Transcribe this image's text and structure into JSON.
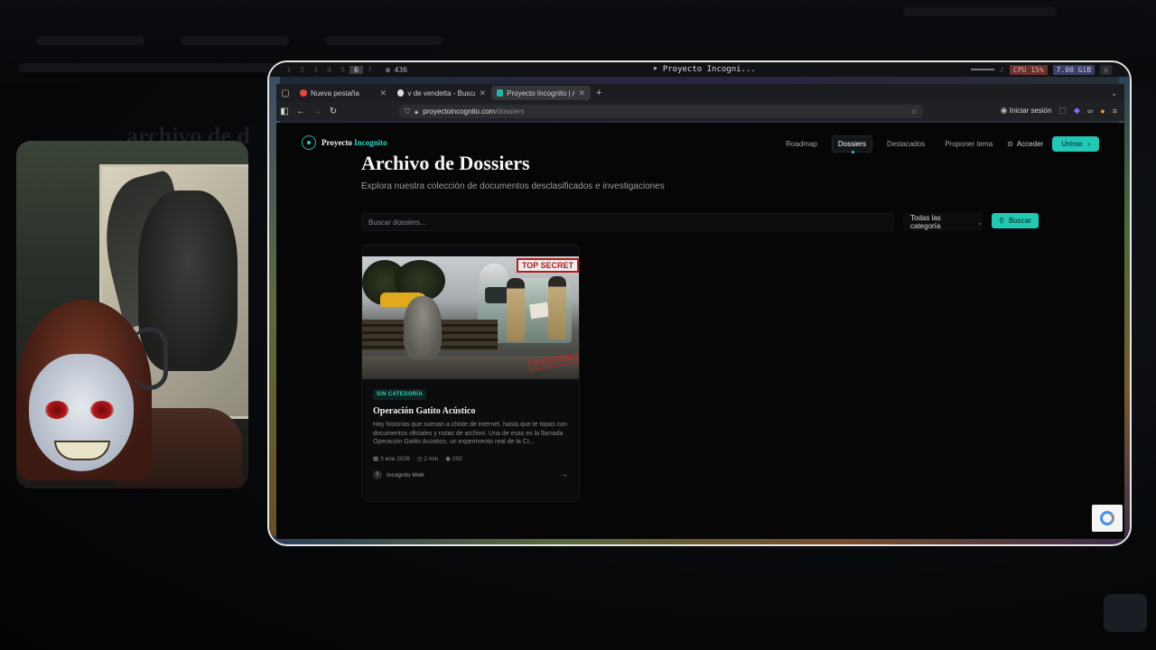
{
  "topbar": {
    "workspaces": [
      "1",
      "2",
      "3",
      "4",
      "5",
      "6",
      "7"
    ],
    "active_workspace": "6",
    "count": "436",
    "window_title": "Proyecto Incogni...",
    "cpu": "CPU 15%",
    "mem": "7.00 GiB"
  },
  "browser": {
    "tabs": [
      {
        "label": "Nueva pestaña",
        "color": "#e8453c"
      },
      {
        "label": "v de vendetta - Buscar",
        "color": "#dddddd"
      },
      {
        "label": "Proyecto Incognito | Arc",
        "color": "#1fb8a6"
      }
    ],
    "url_host": "proyectoincognito.com",
    "url_path": "/dossiers",
    "signin_label": "Iniciar sesión"
  },
  "site": {
    "brand_first": "Proyecto",
    "brand_accent": "Incognito",
    "nav": [
      "Roadmap",
      "Dossiers",
      "Destacados",
      "Proponer tema"
    ],
    "active_nav": "Dossiers",
    "login_label": "Acceder",
    "join_label": "Unirse",
    "page_title": "Archivo de Dossiers",
    "page_subtitle": "Explora nuestra colección de documentos desclasificados e investigaciones",
    "search_placeholder": "Buscar dossiers...",
    "category_select": "Todas las categoría",
    "search_button": "Buscar",
    "accent_color": "#22c8b4"
  },
  "card": {
    "image_sign": "TOP SECRET",
    "image_stamp": "DESCLASIFICADO",
    "category": "SIN CATEGORÍA",
    "title": "Operación Gatito Acústico",
    "excerpt": "Hay historias que suenan a chiste de internet, hasta que te topas con documentos oficiales y notas de archivo. Una de esas es la llamada Operación Gatito Acústico, un experimento real de la CI...",
    "date": "3 ene 2026",
    "read_time": "2 min",
    "views": "202",
    "author_initial": "I",
    "author": "Incognito Web"
  },
  "background": {
    "heading_fragment": "archivo de d"
  }
}
